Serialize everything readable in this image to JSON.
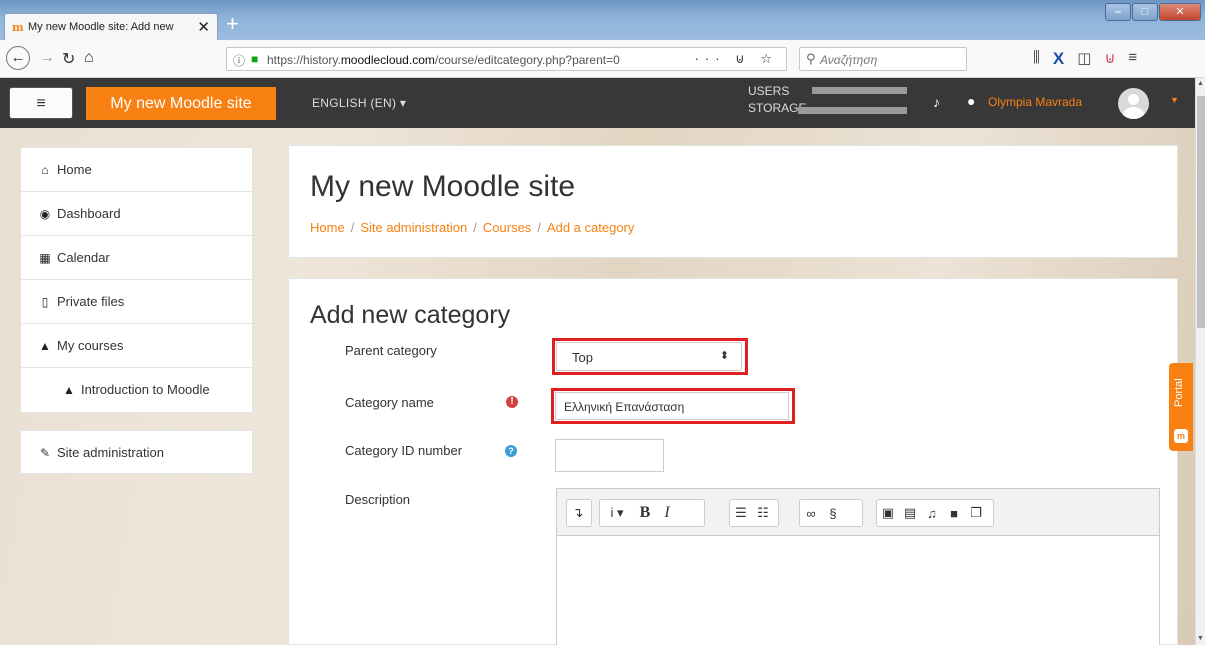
{
  "browser": {
    "tab_title": "My new Moodle site: Add new",
    "tab_favicon": "moodle-logo",
    "url_prefix": "https://history.",
    "url_domain": "moodlecloud.com",
    "url_path": "/course/editcategory.php?parent=0",
    "search_placeholder": "Αναζήτηση",
    "icons": [
      "back-icon",
      "forward-icon",
      "reload-icon",
      "home-icon",
      "library-icon",
      "x-extension-icon",
      "sidebar-icon",
      "pocket-icon",
      "menu-icon"
    ]
  },
  "header": {
    "site_name": "My new Moodle site",
    "language": "ENGLISH (EN)",
    "users_label": "USERS",
    "storage_label": "STORAGE",
    "user_name": "Olympia Mavrada"
  },
  "sidebar": {
    "items": [
      {
        "label": "Home",
        "icon": "home-icon"
      },
      {
        "label": "Dashboard",
        "icon": "dashboard-icon"
      },
      {
        "label": "Calendar",
        "icon": "calendar-icon"
      },
      {
        "label": "Private files",
        "icon": "file-icon"
      },
      {
        "label": "My courses",
        "icon": "graduation-cap-icon"
      },
      {
        "label": "Introduction to Moodle",
        "icon": "graduation-cap-icon"
      }
    ],
    "admin_label": "Site administration"
  },
  "page": {
    "title": "My new Moodle site",
    "breadcrumb": [
      "Home",
      "Site administration",
      "Courses",
      "Add a category"
    ]
  },
  "form": {
    "heading": "Add new category",
    "parent_label": "Parent category",
    "parent_value": "Top",
    "name_label": "Category name",
    "name_value": "Ελληνική Επανάσταση",
    "id_label": "Category ID number",
    "id_value": "",
    "description_label": "Description"
  },
  "portal_label": "Portal",
  "colors": {
    "accent": "#f98012",
    "header_bg": "#383838",
    "highlight": "#e02020"
  }
}
